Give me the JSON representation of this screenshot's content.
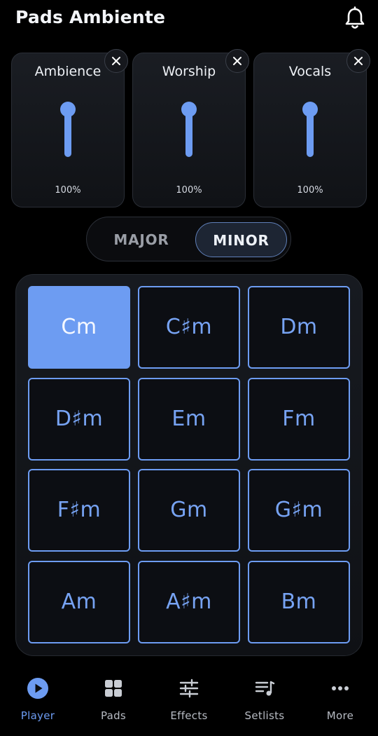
{
  "header": {
    "title": "Pads Ambiente",
    "notification_icon": "bell-icon"
  },
  "mixer": {
    "channels": [
      {
        "name": "Ambience",
        "level_label": "100%",
        "level": 1.0
      },
      {
        "name": "Worship",
        "level_label": "100%",
        "level": 1.0
      },
      {
        "name": "Vocals",
        "level_label": "100%",
        "level": 1.0
      }
    ]
  },
  "scale": {
    "options": [
      "MAJOR",
      "MINOR"
    ],
    "selected": "MINOR"
  },
  "pads": {
    "chords": [
      "Cm",
      "C♯m",
      "Dm",
      "D♯m",
      "Em",
      "Fm",
      "F♯m",
      "Gm",
      "G♯m",
      "Am",
      "A♯m",
      "Bm"
    ],
    "active": "Cm"
  },
  "nav": {
    "items": [
      {
        "label": "Player",
        "icon": "play-circle-icon"
      },
      {
        "label": "Pads",
        "icon": "grid-icon"
      },
      {
        "label": "Effects",
        "icon": "sliders-icon"
      },
      {
        "label": "Setlists",
        "icon": "playlist-icon"
      },
      {
        "label": "More",
        "icon": "more-dots-icon"
      }
    ],
    "active": "Player"
  },
  "colors": {
    "accent": "#6d9cf2",
    "background": "#000000",
    "panel": "#15181d",
    "inactive_text": "#b7bbc3"
  }
}
